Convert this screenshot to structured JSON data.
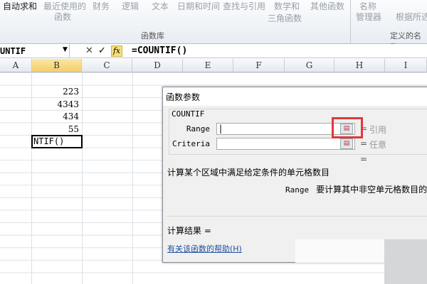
{
  "ribbon": {
    "buttons": [
      "自动求和",
      "最近使用的",
      "财务",
      "逻辑",
      "文本",
      "日期和时间",
      "查找与引用",
      "数学和",
      "其他函数",
      "名称"
    ],
    "sub": [
      "函数",
      "三角函数",
      "管理器",
      "根据所选"
    ],
    "groups": [
      "函数库",
      "定义的名称"
    ]
  },
  "formula_bar": {
    "name_box": "UNTIF",
    "fx": "fx",
    "formula": "=COUNTIF()"
  },
  "columns": [
    "A",
    "B",
    "C",
    "D",
    "E",
    "F",
    "G",
    "H",
    "I"
  ],
  "cells": [
    "223",
    "4343",
    "434",
    "55"
  ],
  "active_cell": "NTIF()",
  "dialog": {
    "title": "函数参数",
    "function_name": "COUNTIF",
    "args": [
      {
        "label": "Range",
        "hint": "引用"
      },
      {
        "label": "Criteria",
        "hint": "任意"
      }
    ],
    "eq": "=",
    "description": "计算某个区域中满足给定条件的单元格数目",
    "param_name": "Range",
    "param_desc": "要计算其中非空单元格数目的区",
    "result": "计算结果 =",
    "help": "有关该函数的帮助(H)"
  }
}
